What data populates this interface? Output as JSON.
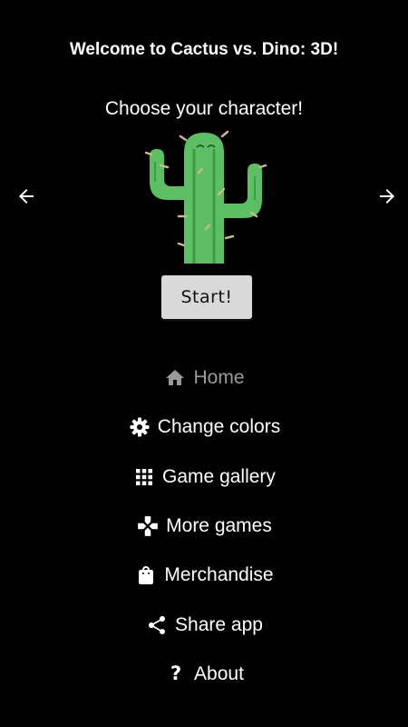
{
  "header": {
    "title": "Welcome to Cactus vs. Dino: 3D!",
    "subtitle": "Choose your character!"
  },
  "character_picker": {
    "previous_icon": "arrow-left-icon",
    "next_icon": "arrow-right-icon",
    "character_icon": "cactus-icon",
    "start_label": "Start!"
  },
  "menu": {
    "items": [
      {
        "label": "Home",
        "icon": "home-icon",
        "state": "disabled"
      },
      {
        "label": "Change colors",
        "icon": "gear-icon"
      },
      {
        "label": "Game gallery",
        "icon": "grid-icon"
      },
      {
        "label": "More games",
        "icon": "gamepad-icon"
      },
      {
        "label": "Merchandise",
        "icon": "shopping-bag-icon"
      },
      {
        "label": "Share app",
        "icon": "share-icon"
      },
      {
        "label": "About",
        "icon": "question-mark-icon"
      }
    ]
  },
  "colors": {
    "background": "#000000",
    "text": "#ffffff",
    "disabled_text": "#9a9a9a",
    "button_bg": "#d9d9d9",
    "cactus_green": "#5cbf63"
  }
}
